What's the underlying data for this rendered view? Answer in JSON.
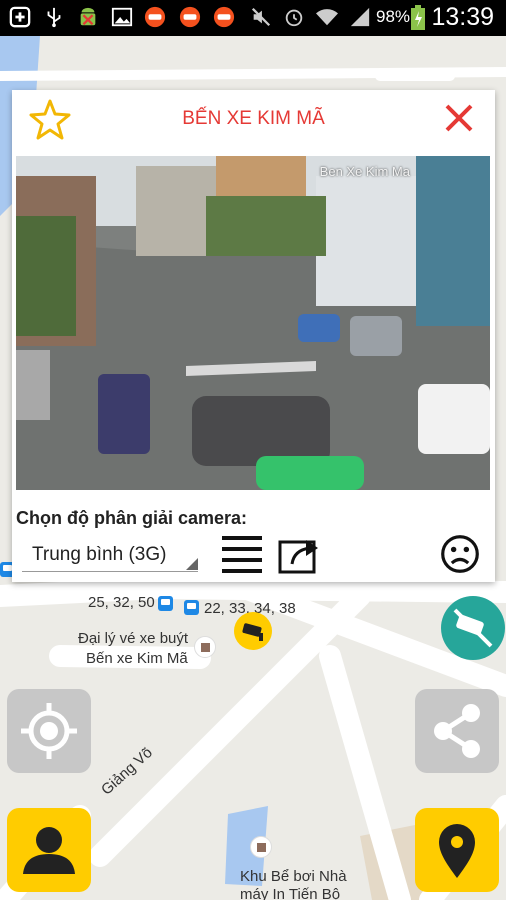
{
  "status_bar": {
    "battery_percent": "98%",
    "time": "13:39",
    "icons": [
      "plus-icon",
      "usb-icon",
      "android-debug-icon",
      "image-icon",
      "traffic-app-icon",
      "traffic-app-icon",
      "traffic-app-icon",
      "mute-icon",
      "alarm-icon",
      "wifi-icon",
      "signal-icon",
      "battery-charging-icon"
    ]
  },
  "dialog": {
    "title": "BẾN XE KIM MÃ",
    "video_overlay": "Ben Xe Kim Ma",
    "resolution_label": "Chọn độ phân giải camera:",
    "resolution_value": "Trung bình (3G)",
    "icons": [
      "star-icon",
      "close-icon",
      "list-icon",
      "share-screen-icon",
      "sad-face-icon"
    ],
    "accent_color": "#e53935"
  },
  "map": {
    "bus_routes": "25, 32, 50",
    "bus_routes_2": "22, 33, 34, 38",
    "poi_1_line1": "Đại lý vé xe buýt",
    "poi_1_line2": "Bến xe Kim Mã",
    "street": "Giảng Võ",
    "poi_2_line1": "Khu Bể bơi Nhà",
    "poi_2_line2": "máy In Tiến Bộ",
    "icons": [
      "camera-marker-icon",
      "camera-off-icon"
    ]
  },
  "buttons": {
    "locate": "locate-icon",
    "share": "share-icon",
    "profile": "user-icon",
    "marker": "map-pin-icon"
  }
}
